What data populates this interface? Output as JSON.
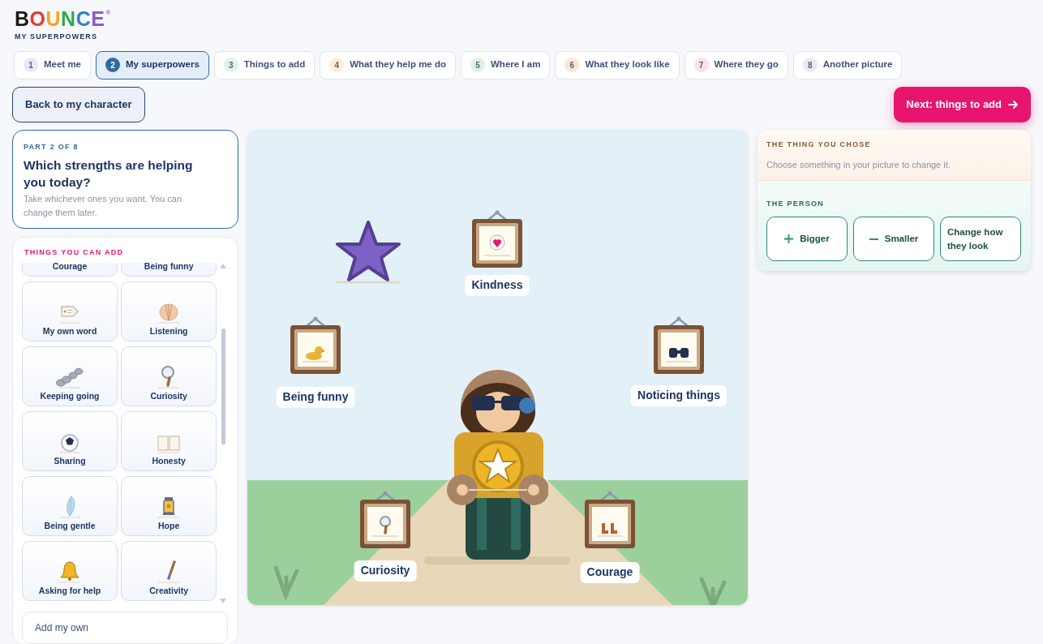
{
  "logo": {
    "letters": [
      {
        "text": "B",
        "color": "#1b1b1b"
      },
      {
        "text": "O",
        "color": "#e53935"
      },
      {
        "text": "U",
        "color": "#f5a524"
      },
      {
        "text": "N",
        "color": "#2eaa4f"
      },
      {
        "text": "C",
        "color": "#2f80c8"
      },
      {
        "text": "E",
        "color": "#8a5cd0"
      }
    ],
    "mark": "®",
    "subtitle": "MY SUPERPOWERS"
  },
  "tabs": [
    {
      "number": "1",
      "label": "Meet me",
      "selected": false,
      "color": "#ebe6f7"
    },
    {
      "number": "2",
      "label": "My superpowers",
      "selected": true,
      "color": "#2f6aa3"
    },
    {
      "number": "3",
      "label": "Things to add",
      "selected": false,
      "color": "#dff1ec"
    },
    {
      "number": "4",
      "label": "What they help me do",
      "selected": false,
      "color": "#fcefd2"
    },
    {
      "number": "5",
      "label": "Where I am",
      "selected": false,
      "color": "#e0f2e4"
    },
    {
      "number": "6",
      "label": "What they look like",
      "selected": false,
      "color": "#fce5d6"
    },
    {
      "number": "7",
      "label": "Where they go",
      "selected": false,
      "color": "#fae1ec"
    },
    {
      "number": "8",
      "label": "Another picture",
      "selected": false,
      "color": "#e7eaf3"
    }
  ],
  "back_button": "Back to my character",
  "next_button": "Next: things to add",
  "question": {
    "step": "PART 2 OF 8",
    "title": "Which strengths are helping you today?",
    "hint": "Take whichever ones you want. You can change them later."
  },
  "palette": {
    "title": "THINGS YOU CAN ADD",
    "tiles": [
      {
        "label": "Courage"
      },
      {
        "label": "Being funny"
      },
      {
        "label": "My own word"
      },
      {
        "label": "Listening"
      },
      {
        "label": "Keeping going"
      },
      {
        "label": "Curiosity"
      },
      {
        "label": "Sharing"
      },
      {
        "label": "Honesty"
      },
      {
        "label": "Being gentle"
      },
      {
        "label": "Hope"
      },
      {
        "label": "Asking for help"
      },
      {
        "label": "Creativity"
      }
    ],
    "add_own": {
      "placeholder": "Add my own"
    }
  },
  "canvas": {
    "items": [
      {
        "kind": "star"
      },
      {
        "kind": "frame",
        "label": "Kindness"
      },
      {
        "kind": "frame",
        "label": "Being funny"
      },
      {
        "kind": "frame",
        "label": "Noticing things"
      },
      {
        "kind": "frame",
        "label": "Curiosity"
      },
      {
        "kind": "frame",
        "label": "Courage"
      }
    ]
  },
  "selection": {
    "title": "THE THING YOU CHOSE",
    "hint": "Choose something in your picture to change it."
  },
  "person_tools": {
    "title": "THE PERSON",
    "buttons": [
      {
        "label": "Bigger",
        "kind": "plus"
      },
      {
        "label": "Smaller",
        "kind": "minus"
      },
      {
        "label": "Change how they look",
        "kind": "text"
      }
    ]
  }
}
